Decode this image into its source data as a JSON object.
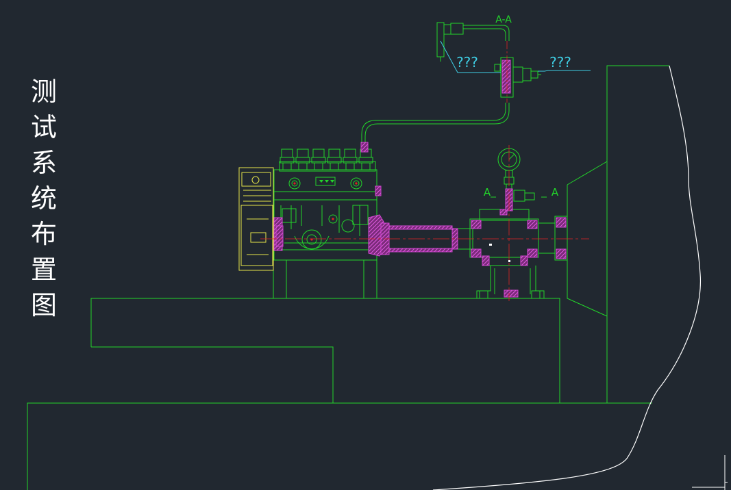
{
  "drawing": {
    "vertical_title": "测试系统布置图",
    "section_label_top": "A-A",
    "section_mark_left": "A",
    "section_mark_right": "A",
    "callout_left": "???",
    "callout_right": "???"
  },
  "colors": {
    "background": "#212830",
    "outline_green": "#22d62a",
    "hatch_magenta": "#d447d4",
    "leader_cyan": "#3fd0e6",
    "centerline_red": "#e02424",
    "pump_yellow": "#e6e64a",
    "contour_white": "#ffffff"
  }
}
